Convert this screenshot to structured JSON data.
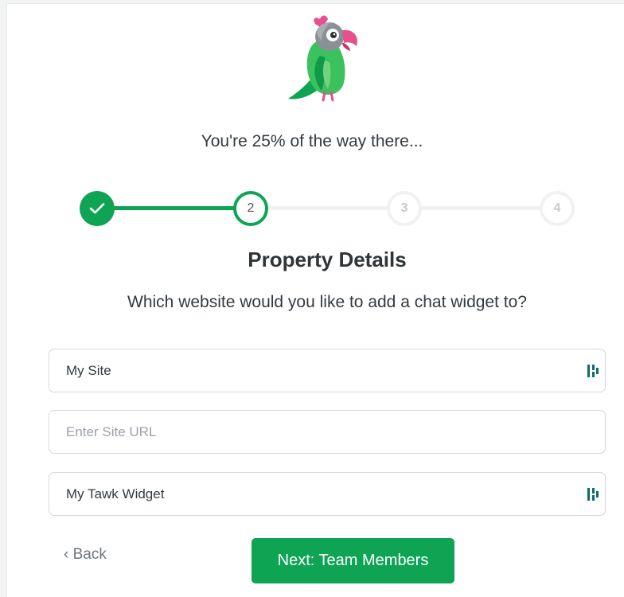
{
  "header": {
    "progress_text": "You're 25% of the way there...",
    "progress_percent": 25
  },
  "stepper": {
    "steps": [
      {
        "label": "",
        "state": "done",
        "icon": "checkmark-icon"
      },
      {
        "label": "2",
        "state": "current"
      },
      {
        "label": "3",
        "state": "todo"
      },
      {
        "label": "4",
        "state": "todo"
      }
    ]
  },
  "section": {
    "title": "Property Details",
    "subtitle": "Which website would you like to add a chat widget to?"
  },
  "form": {
    "site_name": {
      "value": "My Site",
      "placeholder": ""
    },
    "site_url": {
      "value": "",
      "placeholder": "Enter Site URL"
    },
    "widget_name": {
      "value": "My Tawk Widget",
      "placeholder": ""
    }
  },
  "nav": {
    "back_label": "Back",
    "back_icon": "chevron-left-icon",
    "next_label": "Next: Team Members"
  },
  "colors": {
    "accent": "#0ea453",
    "text": "#333a3f",
    "muted": "#6e767c",
    "border": "#d4d8dc"
  }
}
